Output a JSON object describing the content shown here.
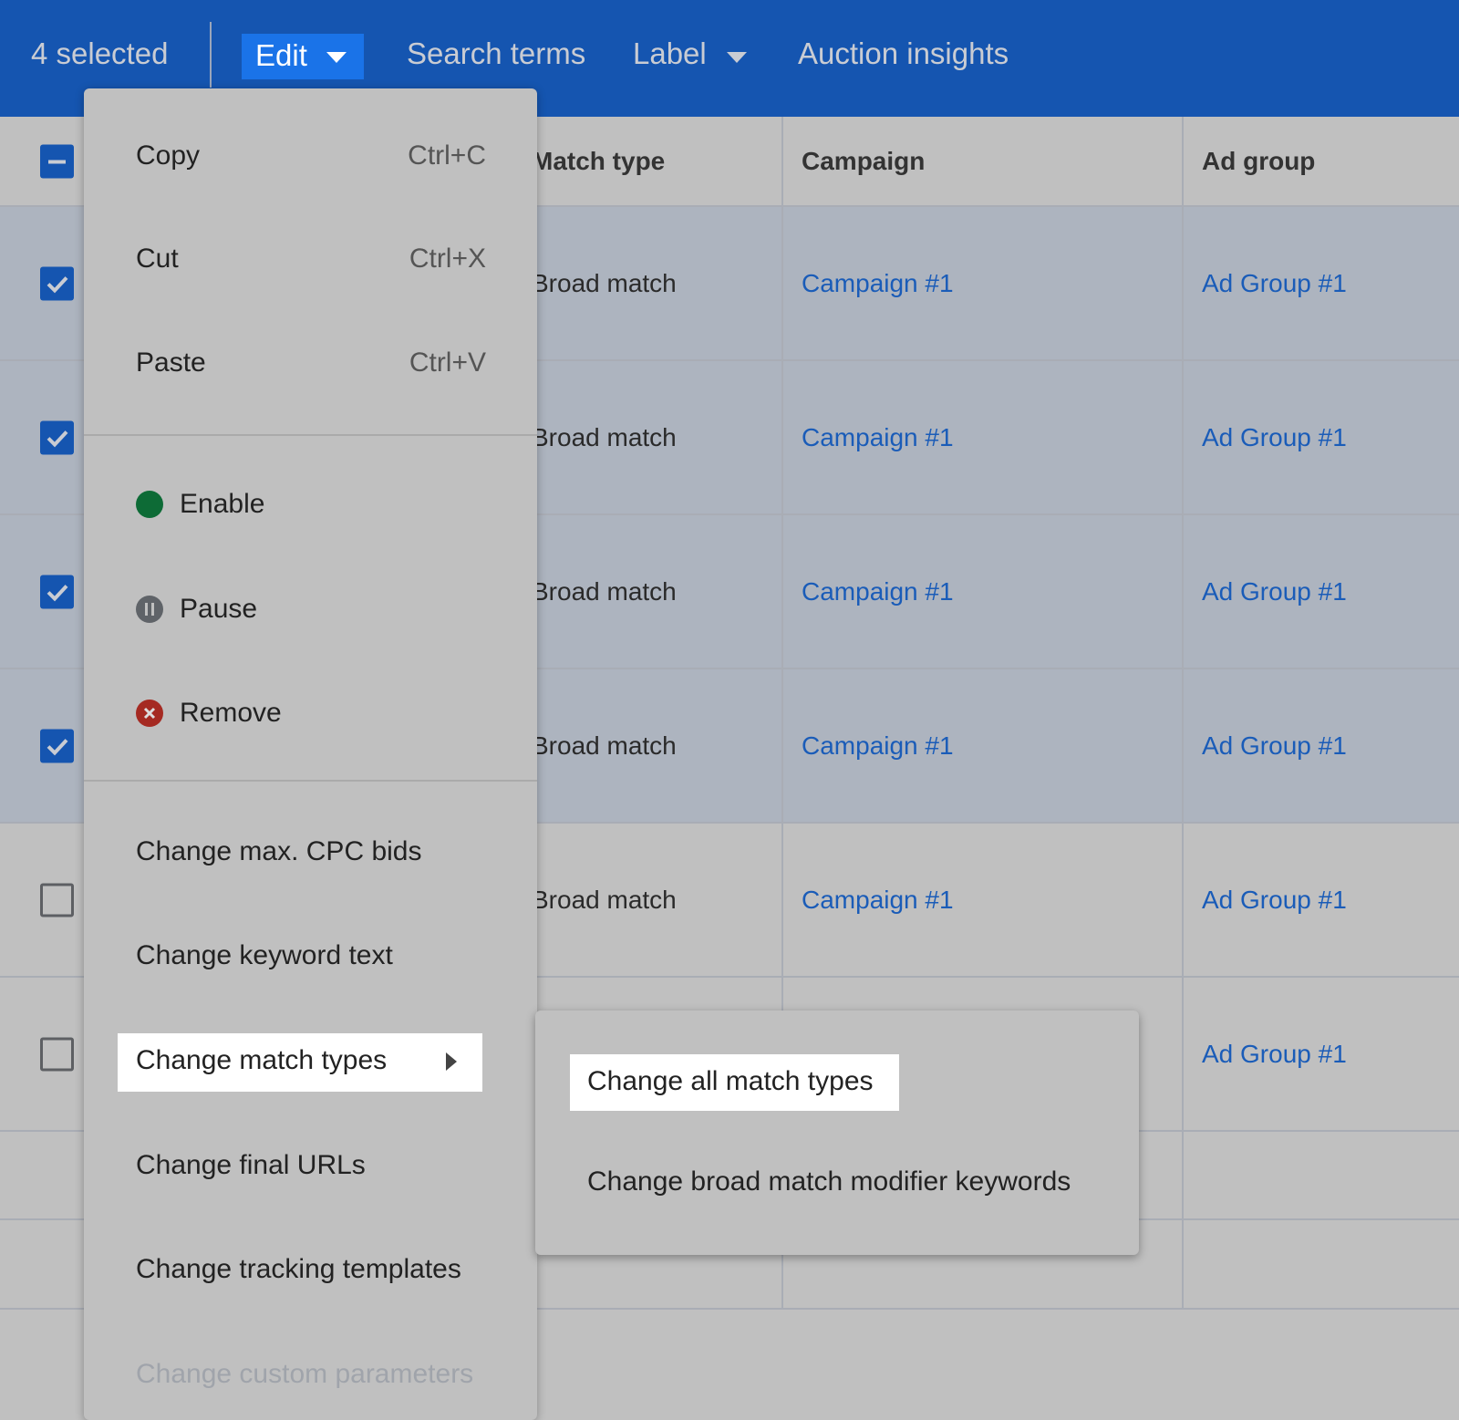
{
  "toolbar": {
    "selected_count": "4 selected",
    "edit_label": "Edit",
    "search_terms_label": "Search terms",
    "label_label": "Label",
    "auction_insights_label": "Auction insights"
  },
  "table": {
    "columns": [
      "Match type",
      "Campaign",
      "Ad group"
    ],
    "rows": [
      {
        "selected": true,
        "match_type": "Broad match",
        "campaign": "Campaign #1",
        "ad_group": "Ad Group #1"
      },
      {
        "selected": true,
        "match_type": "Broad match",
        "campaign": "Campaign #1",
        "ad_group": "Ad Group #1"
      },
      {
        "selected": true,
        "match_type": "Broad match",
        "campaign": "Campaign #1",
        "ad_group": "Ad Group #1"
      },
      {
        "selected": true,
        "match_type": "Broad match",
        "campaign": "Campaign #1",
        "ad_group": "Ad Group #1"
      },
      {
        "selected": false,
        "match_type": "Broad match",
        "campaign": "Campaign #1",
        "ad_group": "Ad Group #1"
      },
      {
        "selected": false,
        "ad_group": "Ad Group #1"
      }
    ]
  },
  "edit_menu": {
    "copy": {
      "label": "Copy",
      "shortcut": "Ctrl+C"
    },
    "cut": {
      "label": "Cut",
      "shortcut": "Ctrl+X"
    },
    "paste": {
      "label": "Paste",
      "shortcut": "Ctrl+V"
    },
    "enable": "Enable",
    "pause": "Pause",
    "remove": "Remove",
    "change_bids": "Change max. CPC bids",
    "change_keyword_text": "Change keyword text",
    "change_match_types": "Change match types",
    "change_final_urls": "Change final URLs",
    "change_tracking_templates": "Change tracking templates",
    "change_custom_parameters": "Change custom parameters"
  },
  "submenu": {
    "change_all": "Change all match types",
    "change_bmm": "Change broad match modifier keywords"
  },
  "colors": {
    "toolbar": "#1555b0",
    "edit_button": "#1a73e8",
    "link": "#1a5cb8",
    "enable": "#0d6b36",
    "pause": "#5f6368",
    "remove": "#a52a22"
  }
}
